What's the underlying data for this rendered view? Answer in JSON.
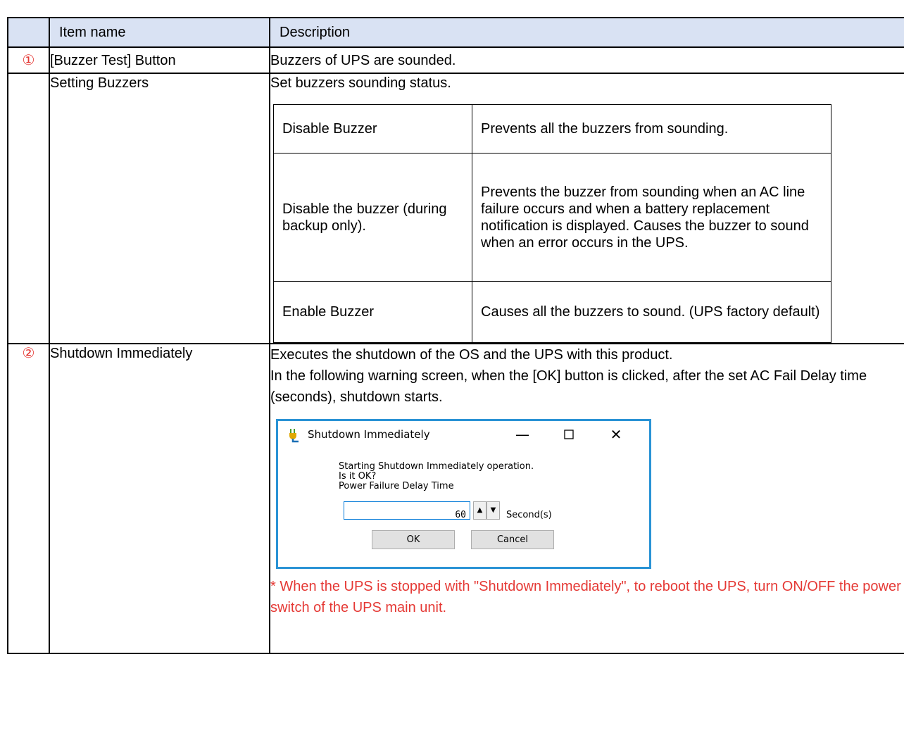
{
  "header": {
    "item_name": "Item name",
    "description": "Description"
  },
  "rows": {
    "buzzer_test": {
      "number": "①",
      "name": "[Buzzer Test] Button",
      "description": "Buzzers of UPS are sounded."
    },
    "setting_buzzers": {
      "name": "Setting Buzzers",
      "description": "Set buzzers sounding status.",
      "options": [
        {
          "name": "Disable Buzzer",
          "description": "Prevents all the buzzers from sounding."
        },
        {
          "name": "Disable the buzzer (during backup only).",
          "description": "Prevents the buzzer from sounding when an AC line failure occurs and when a battery replacement notification is displayed. Causes the buzzer to sound when an error occurs in the UPS."
        },
        {
          "name": "Enable Buzzer",
          "description": "Causes all the buzzers to sound. (UPS factory default)"
        }
      ]
    },
    "shutdown": {
      "number": "②",
      "name": "Shutdown Immediately",
      "description_line1": "Executes the shutdown of the OS and the UPS with this product.",
      "description_line2": "In the following warning screen, when the [OK] button is clicked, after the set AC Fail Delay time (seconds), shutdown starts.",
      "note": "* When the UPS is stopped with \"Shutdown Immediately\", to reboot the UPS, turn ON/OFF the power switch of the UPS main unit."
    }
  },
  "dialog": {
    "title": "Shutdown Immediately",
    "message": "Starting Shutdown Immediately operation.\nIs it OK?\nPower Failure Delay Time",
    "seconds_value": "60",
    "unit": "Second(s)",
    "ok": "OK",
    "cancel": "Cancel",
    "icons": {
      "app": "power-plug-icon",
      "minimize": "minimize-icon",
      "maximize": "maximize-icon",
      "close": "close-icon",
      "up": "spin-up-icon",
      "down": "spin-down-icon"
    },
    "accent_color": "#2a93d5"
  },
  "colors": {
    "header_bg": "#d9e2f3",
    "number": "#e53935",
    "note": "#e53935"
  }
}
